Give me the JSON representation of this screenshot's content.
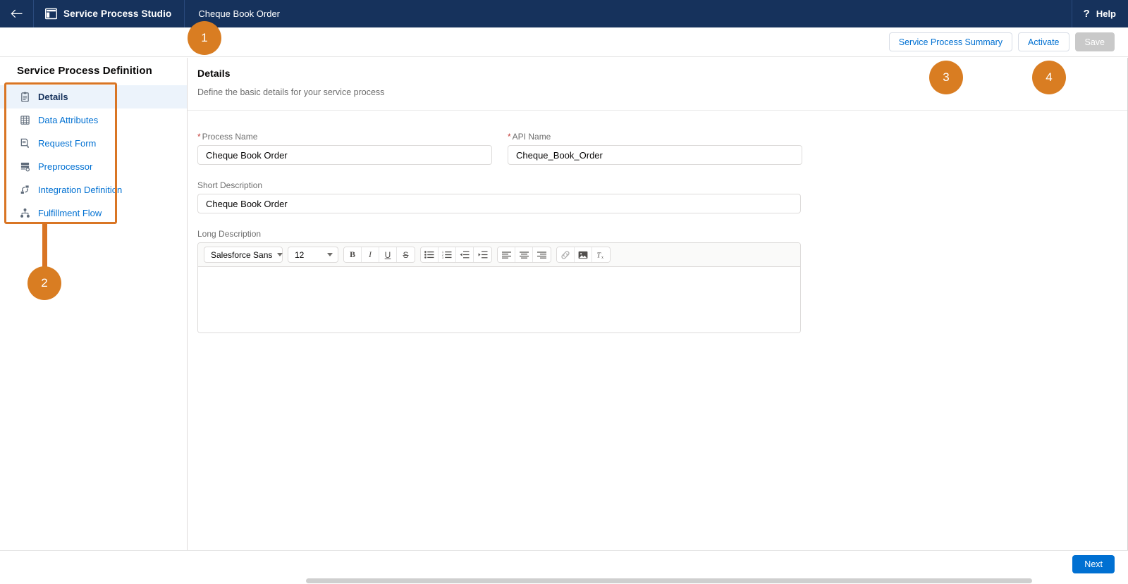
{
  "topbar": {
    "back_icon": "arrow-left-icon",
    "app_icon": "panel-layout-icon",
    "app_title": "Service Process Studio",
    "record_name": "Cheque Book Order",
    "help_icon": "question-mark-icon",
    "help_label": "Help"
  },
  "actionbar": {
    "summary_label": "Service Process Summary",
    "activate_label": "Activate",
    "save_label": "Save"
  },
  "sidebar": {
    "title": "Service Process Definition",
    "items": [
      {
        "label": "Details",
        "icon": "clipboard-icon",
        "active": true
      },
      {
        "label": "Data Attributes",
        "icon": "table-grid-icon",
        "active": false
      },
      {
        "label": "Request Form",
        "icon": "form-edit-icon",
        "active": false
      },
      {
        "label": "Preprocessor",
        "icon": "server-gear-icon",
        "active": false
      },
      {
        "label": "Integration Definition",
        "icon": "integration-flow-icon",
        "active": false
      },
      {
        "label": "Fulfillment Flow",
        "icon": "hierarchy-icon",
        "active": false
      }
    ]
  },
  "main": {
    "title": "Details",
    "subtitle": "Define the basic details for your service process",
    "fields": {
      "process_name": {
        "label": "Process Name",
        "required": true,
        "value": "Cheque Book Order",
        "placeholder": ""
      },
      "api_name": {
        "label": "API Name",
        "required": true,
        "value": "Cheque_Book_Order",
        "placeholder": ""
      },
      "short_description": {
        "label": "Short Description",
        "required": false,
        "value": "Cheque Book Order",
        "placeholder": ""
      },
      "long_description": {
        "label": "Long Description",
        "required": false,
        "value": "",
        "placeholder": ""
      }
    },
    "rich_text_toolbar": {
      "font_family": "Salesforce Sans",
      "font_size": "12",
      "buttons": [
        {
          "name": "bold-icon",
          "glyph": "B"
        },
        {
          "name": "italic-icon",
          "glyph": "I"
        },
        {
          "name": "underline-icon",
          "glyph": "U"
        },
        {
          "name": "strikethrough-icon",
          "glyph": "S"
        },
        {
          "name": "bulleted-list-icon",
          "glyph": ""
        },
        {
          "name": "numbered-list-icon",
          "glyph": ""
        },
        {
          "name": "outdent-icon",
          "glyph": ""
        },
        {
          "name": "indent-icon",
          "glyph": ""
        },
        {
          "name": "align-left-icon",
          "glyph": ""
        },
        {
          "name": "align-center-icon",
          "glyph": ""
        },
        {
          "name": "align-right-icon",
          "glyph": ""
        },
        {
          "name": "link-icon",
          "glyph": ""
        },
        {
          "name": "image-icon",
          "glyph": ""
        },
        {
          "name": "remove-formatting-icon",
          "glyph": "Tx"
        }
      ]
    }
  },
  "bottombar": {
    "next_label": "Next"
  },
  "annotations": {
    "color": "#d97d22",
    "box_color": "#d97524",
    "markers": [
      {
        "id": "1",
        "number": "1"
      },
      {
        "id": "2",
        "number": "2"
      },
      {
        "id": "3",
        "number": "3"
      },
      {
        "id": "4",
        "number": "4"
      }
    ]
  }
}
